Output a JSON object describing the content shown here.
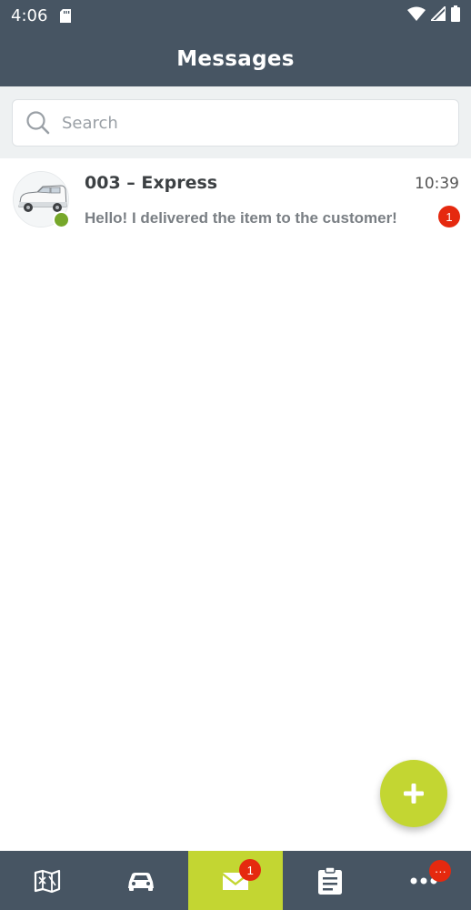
{
  "status_bar": {
    "time": "4:06"
  },
  "app_bar": {
    "title": "Messages"
  },
  "search": {
    "placeholder": "Search"
  },
  "conversations": [
    {
      "name": "003 – Express",
      "time": "10:39",
      "preview": "Hello! I delivered the item to the customer!",
      "unread_count": "1",
      "online": true
    }
  ],
  "bottom_nav": {
    "items": [
      {
        "icon": "map-icon"
      },
      {
        "icon": "car-icon"
      },
      {
        "icon": "mail-icon",
        "badge": "1",
        "active": true
      },
      {
        "icon": "clipboard-icon"
      },
      {
        "icon": "more-icon",
        "badge": "···"
      }
    ]
  },
  "colors": {
    "header": "#475563",
    "accent": "#c3d632",
    "badge": "#e5290f",
    "online": "#76a72a"
  }
}
